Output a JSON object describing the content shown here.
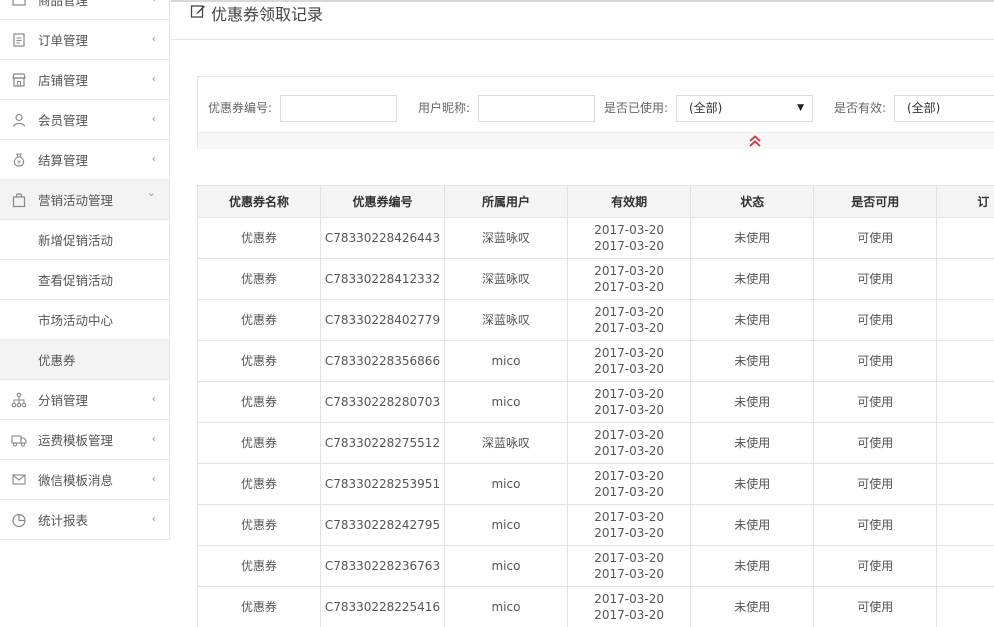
{
  "sidebar": {
    "items": [
      {
        "label": "商品管理",
        "icon": "product-icon"
      },
      {
        "label": "订单管理",
        "icon": "order-icon"
      },
      {
        "label": "店铺管理",
        "icon": "store-icon"
      },
      {
        "label": "会员管理",
        "icon": "member-icon"
      },
      {
        "label": "结算管理",
        "icon": "money-bag-icon"
      },
      {
        "label": "营销活动管理",
        "icon": "shopping-bag-icon"
      },
      {
        "label": "分销管理",
        "icon": "org-tree-icon"
      },
      {
        "label": "运费模板管理",
        "icon": "truck-icon"
      },
      {
        "label": "微信模板消息",
        "icon": "message-icon"
      },
      {
        "label": "统计报表",
        "icon": "pie-chart-icon"
      }
    ],
    "submenu": [
      {
        "label": "新增促销活动"
      },
      {
        "label": "查看促销活动"
      },
      {
        "label": "市场活动中心"
      },
      {
        "label": "优惠券"
      }
    ],
    "chevron_collapsed": "‹",
    "chevron_expanded": "⌄"
  },
  "page": {
    "title": "优惠券领取记录",
    "title_icon": "edit-icon"
  },
  "filters": {
    "coupon_no_label": "优惠券编号:",
    "coupon_no_value": "",
    "nickname_label": "用户昵称:",
    "nickname_value": "",
    "used_label": "是否已使用:",
    "used_value": "(全部)",
    "valid_label": "是否有效:",
    "valid_value": "(全部)",
    "collapse_icon": "double-chevron-up-icon",
    "accent_color": "#d9303a"
  },
  "table": {
    "headers": [
      "优惠券名称",
      "优惠券编号",
      "所属用户",
      "有效期",
      "状态",
      "是否可用",
      "订"
    ],
    "rows": [
      {
        "name": "优惠券",
        "code": "C78330228426443",
        "user": "深蓝咏叹",
        "start": "2017-03-20",
        "end": "2017-03-20",
        "status": "未使用",
        "available": "可使用"
      },
      {
        "name": "优惠券",
        "code": "C78330228412332",
        "user": "深蓝咏叹",
        "start": "2017-03-20",
        "end": "2017-03-20",
        "status": "未使用",
        "available": "可使用"
      },
      {
        "name": "优惠券",
        "code": "C78330228402779",
        "user": "深蓝咏叹",
        "start": "2017-03-20",
        "end": "2017-03-20",
        "status": "未使用",
        "available": "可使用"
      },
      {
        "name": "优惠券",
        "code": "C78330228356866",
        "user": "mico",
        "start": "2017-03-20",
        "end": "2017-03-20",
        "status": "未使用",
        "available": "可使用"
      },
      {
        "name": "优惠券",
        "code": "C78330228280703",
        "user": "mico",
        "start": "2017-03-20",
        "end": "2017-03-20",
        "status": "未使用",
        "available": "可使用"
      },
      {
        "name": "优惠券",
        "code": "C78330228275512",
        "user": "深蓝咏叹",
        "start": "2017-03-20",
        "end": "2017-03-20",
        "status": "未使用",
        "available": "可使用"
      },
      {
        "name": "优惠券",
        "code": "C78330228253951",
        "user": "mico",
        "start": "2017-03-20",
        "end": "2017-03-20",
        "status": "未使用",
        "available": "可使用"
      },
      {
        "name": "优惠券",
        "code": "C78330228242795",
        "user": "mico",
        "start": "2017-03-20",
        "end": "2017-03-20",
        "status": "未使用",
        "available": "可使用"
      },
      {
        "name": "优惠券",
        "code": "C78330228236763",
        "user": "mico",
        "start": "2017-03-20",
        "end": "2017-03-20",
        "status": "未使用",
        "available": "可使用"
      },
      {
        "name": "优惠券",
        "code": "C78330228225416",
        "user": "mico",
        "start": "2017-03-20",
        "end": "2017-03-20",
        "status": "未使用",
        "available": "可使用"
      }
    ]
  }
}
